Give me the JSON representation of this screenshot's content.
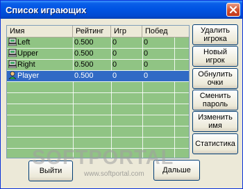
{
  "window": {
    "title": "Список играющих"
  },
  "table": {
    "columns": [
      "Имя",
      "Рейтинг",
      "Игр",
      "Побед"
    ],
    "rows": [
      {
        "name": "Left",
        "rating": "0.500",
        "games": "0",
        "wins": "0",
        "icon": "computer-icon",
        "selected": false
      },
      {
        "name": "Upper",
        "rating": "0.500",
        "games": "0",
        "wins": "0",
        "icon": "computer-icon",
        "selected": false
      },
      {
        "name": "Right",
        "rating": "0.500",
        "games": "0",
        "wins": "0",
        "icon": "computer-icon",
        "selected": false
      },
      {
        "name": "Player",
        "rating": "0.500",
        "games": "0",
        "wins": "0",
        "icon": "person-icon",
        "selected": true
      }
    ],
    "background_color": "#90c484",
    "selection_color": "#316ac5"
  },
  "side_buttons": {
    "delete_player": "Удалить игрока",
    "new_player": "Новый игрок",
    "reset_points": "Обнулить очки",
    "change_password": "Сменить пароль",
    "change_name": "Изменить имя",
    "statistics": "Статистика"
  },
  "bottom_buttons": {
    "exit": "Выйти",
    "next": "Дальше"
  },
  "watermark": {
    "brand": "SOFTPORTAL",
    "url": "www.softportal.com"
  }
}
